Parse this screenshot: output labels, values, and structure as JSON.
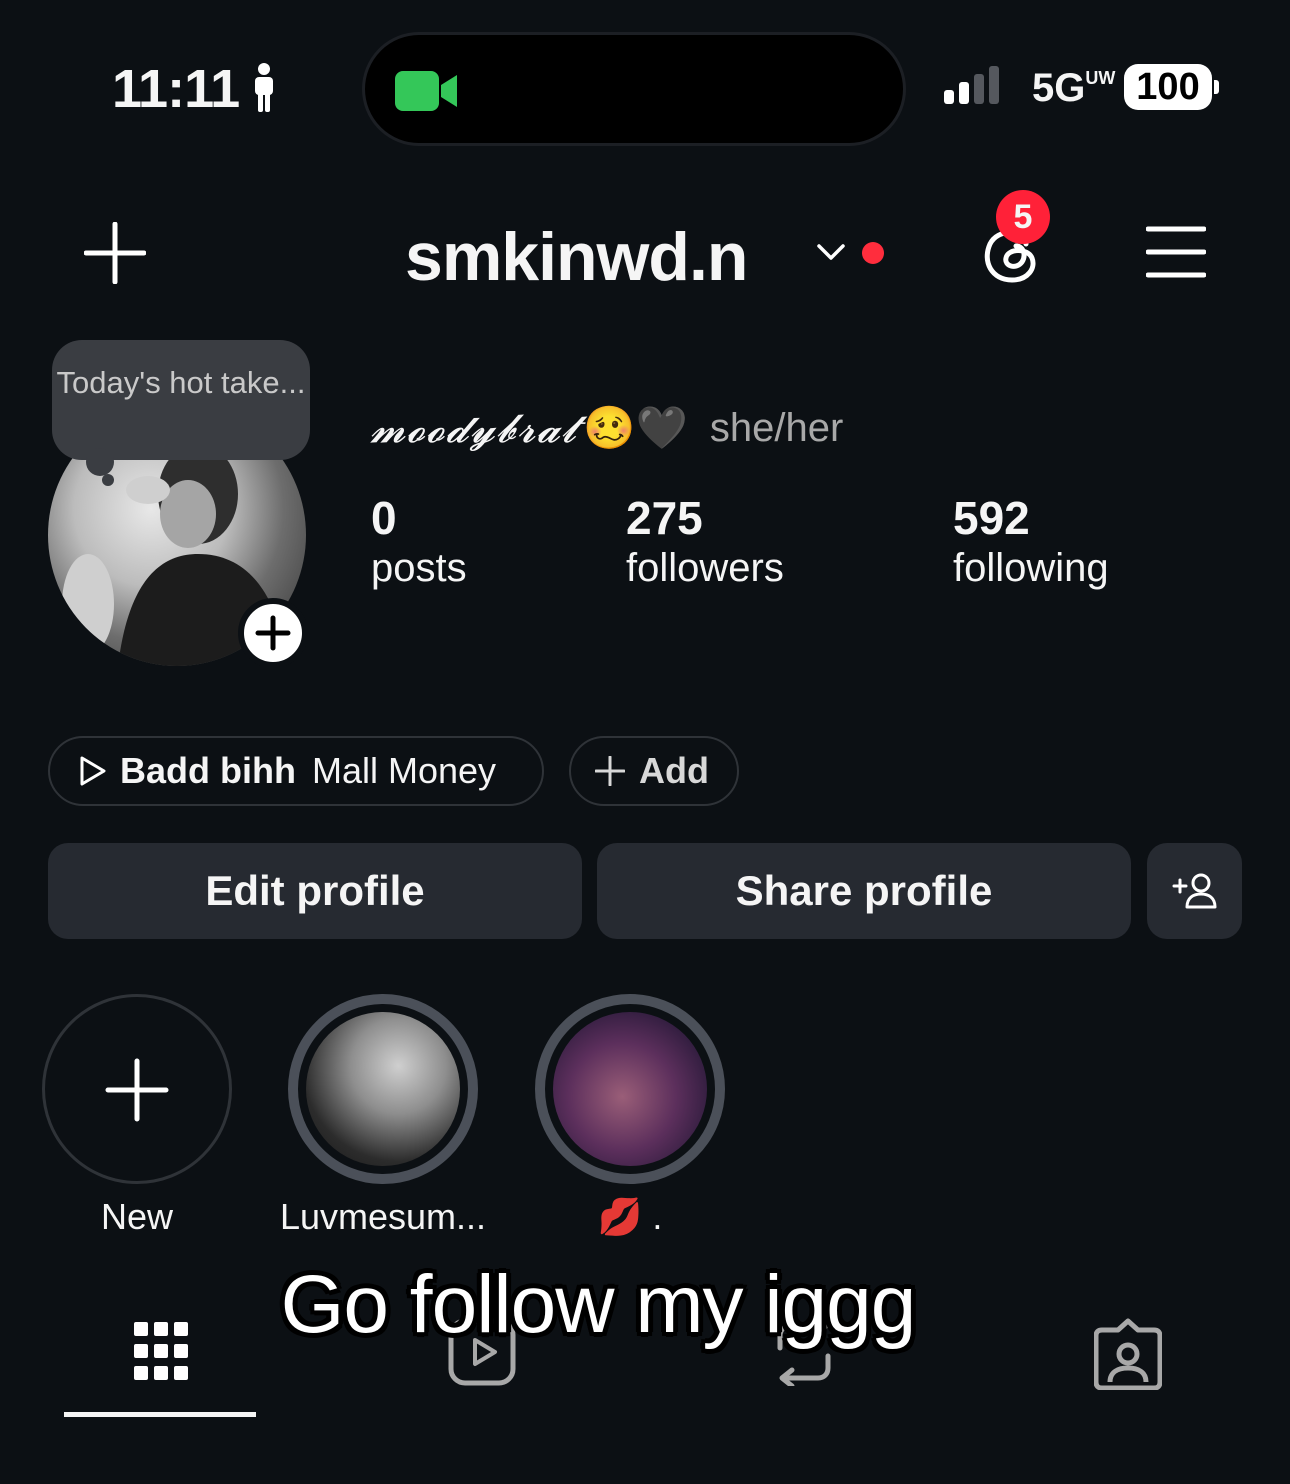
{
  "status_bar": {
    "time": "11:11",
    "network": "5G",
    "network_suffix": "UW",
    "battery": "100"
  },
  "header": {
    "username": "smkinwd.n",
    "notification_count": "5"
  },
  "profile": {
    "note_text": "Today's hot take...",
    "display_name": "𝓶𝓸𝓸𝓭𝔂𝓫𝓻𝓪𝓽",
    "display_emoji": "🥴🖤",
    "pronouns": "she/her",
    "stats": {
      "posts_count": "0",
      "posts_label": "posts",
      "followers_count": "275",
      "followers_label": "followers",
      "following_count": "592",
      "following_label": "following"
    },
    "music": {
      "track": "Badd bihh",
      "artist": "Mall Money"
    },
    "add_label": "Add"
  },
  "actions": {
    "edit_label": "Edit profile",
    "share_label": "Share profile"
  },
  "highlights": [
    {
      "label": "New"
    },
    {
      "label": "Luvmesum..."
    },
    {
      "label": "💋 ."
    }
  ],
  "caption": "Go follow my iggg",
  "tabs": [
    "grid-icon",
    "reels-icon",
    "reposts-icon",
    "tagged-icon"
  ],
  "colors": {
    "background": "#0c1014",
    "button": "#262a31",
    "badge": "#ff2138",
    "facetime_green": "#34c759"
  }
}
